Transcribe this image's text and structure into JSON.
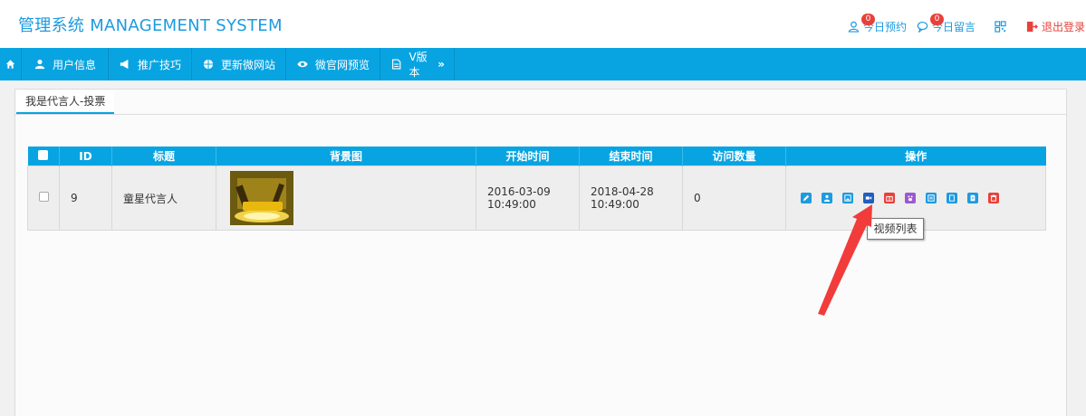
{
  "header": {
    "brand": "管理系统 MANAGEMENT SYSTEM",
    "appointments_label": "今日预约",
    "appointments_count": "0",
    "messages_label": "今日留言",
    "messages_count": "0",
    "logout_label": "退出登录"
  },
  "nav": {
    "items": [
      {
        "label": "用户信息",
        "icon": "user-icon"
      },
      {
        "label": "推广技巧",
        "icon": "megaphone-icon"
      },
      {
        "label": "更新微网站",
        "icon": "globe-icon"
      },
      {
        "label": "微官网预览",
        "icon": "eye-icon"
      },
      {
        "label": "V版本",
        "icon": "document-icon"
      }
    ]
  },
  "tab": {
    "label": "我是代言人-投票"
  },
  "table": {
    "columns": [
      "ID",
      "标题",
      "背景图",
      "开始时间",
      "结束时间",
      "访问数量",
      "操作"
    ],
    "rows": [
      {
        "id": "9",
        "title": "童星代言人",
        "start_date": "2016-03-09",
        "start_time": "10:49:00",
        "end_date": "2018-04-28",
        "end_time": "10:49:00",
        "visits": "0"
      }
    ]
  },
  "tooltip": {
    "text": "视频列表"
  },
  "colors": {
    "accent": "#08a4e2",
    "danger": "#e8413a",
    "purple": "#9b59d0",
    "navy": "#1f5fbf"
  }
}
